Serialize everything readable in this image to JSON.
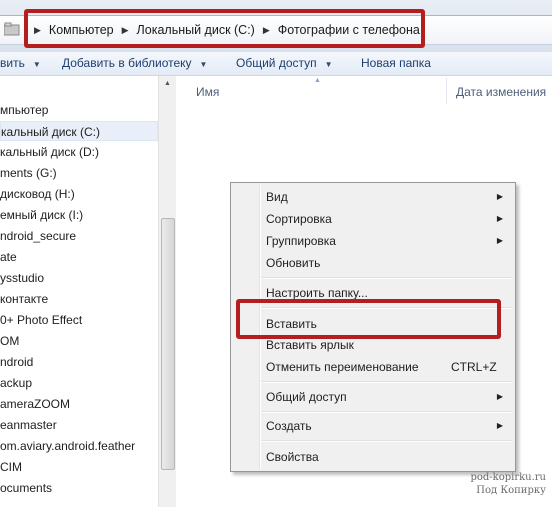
{
  "breadcrumb": [
    "Компьютер",
    "Локальный диск (C:)",
    "Фотографии с телефона"
  ],
  "toolbar": {
    "organize_label": "вить",
    "library_label": "Добавить в библиотеку",
    "share_label": "Общий доступ",
    "newfolder_label": "Новая папка"
  },
  "nav": {
    "items": [
      {
        "label": "мпьютер"
      },
      {
        "label": "кальный диск (C:)",
        "selected": true
      },
      {
        "label": "кальный диск (D:)"
      },
      {
        "label": "ments (G:)"
      },
      {
        "label": "дисковод (H:)"
      },
      {
        "label": "емный диск (I:)"
      },
      {
        "label": "ndroid_secure"
      },
      {
        "label": "ate"
      },
      {
        "label": "ysstudio"
      },
      {
        "label": "контакте"
      },
      {
        "label": "0+ Photo Effect"
      },
      {
        "label": "OM"
      },
      {
        "label": "ndroid"
      },
      {
        "label": "ackup"
      },
      {
        "label": "ameraZOOM"
      },
      {
        "label": "eanmaster"
      },
      {
        "label": "om.aviary.android.feather"
      },
      {
        "label": "CIM"
      },
      {
        "label": "ocuments"
      }
    ]
  },
  "columns": {
    "name": "Имя",
    "date": "Дата изменения"
  },
  "context_menu": {
    "view": "Вид",
    "sort": "Сортировка",
    "group": "Группировка",
    "refresh": "Обновить",
    "customize": "Настроить папку...",
    "paste": "Вставить",
    "paste_shortcut": "Вставить ярлык",
    "undo_rename": "Отменить переименование",
    "undo_shortcut": "CTRL+Z",
    "share": "Общий доступ",
    "create": "Создать",
    "properties": "Свойства"
  },
  "watermark": {
    "line1": "pod-kopirku.ru",
    "line2": "Под Копирку"
  },
  "colors": {
    "highlight": "#b41e1e",
    "toolbar_text": "#1e3f6e"
  }
}
